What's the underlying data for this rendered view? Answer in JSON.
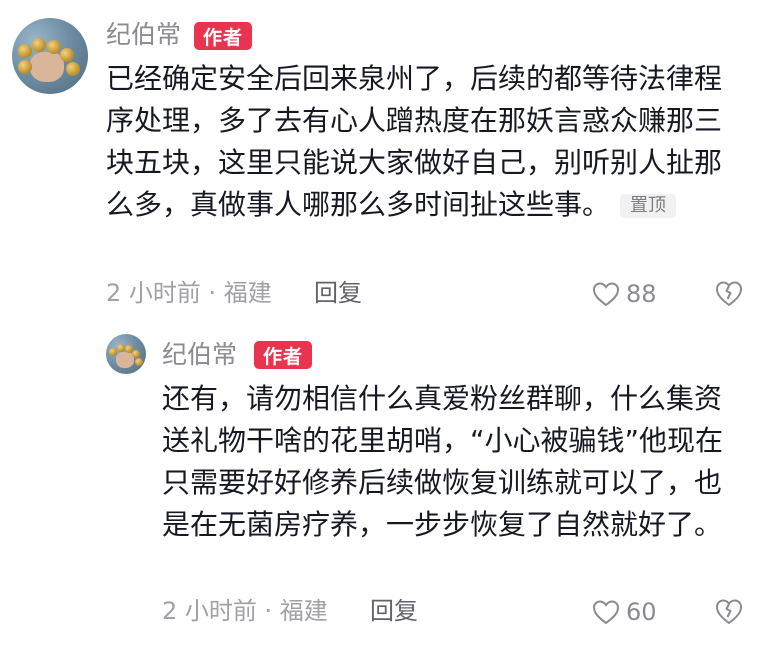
{
  "comments": [
    {
      "username": "纪伯常",
      "badge": "作者",
      "text": "已经确定安全后回来泉州了，后续的都等待法律程序处理，多了去有心人蹭热度在那妖言惑众赚那三块五块，这里只能说大家做好自己，别听别人扯那么多，真做事人哪那么多时间扯这些事。",
      "pin_label": "置顶",
      "time_location": "2 小时前 · 福建",
      "reply_label": "回复",
      "likes": "88",
      "icons": [
        "avatar",
        "heart-icon",
        "dislike-icon"
      ]
    },
    {
      "username": "纪伯常",
      "badge": "作者",
      "text": "还有，请勿相信什么真爱粉丝群聊，什么集资送礼物干啥的花里胡哨，“小心被骗钱”他现在只需要好好修养后续做恢复训练就可以了，也是在无菌房疗养，一步步恢复了自然就好了。",
      "time_location": "2 小时前 · 福建",
      "reply_label": "回复",
      "likes": "60",
      "icons": [
        "avatar",
        "heart-icon",
        "dislike-icon"
      ]
    }
  ]
}
